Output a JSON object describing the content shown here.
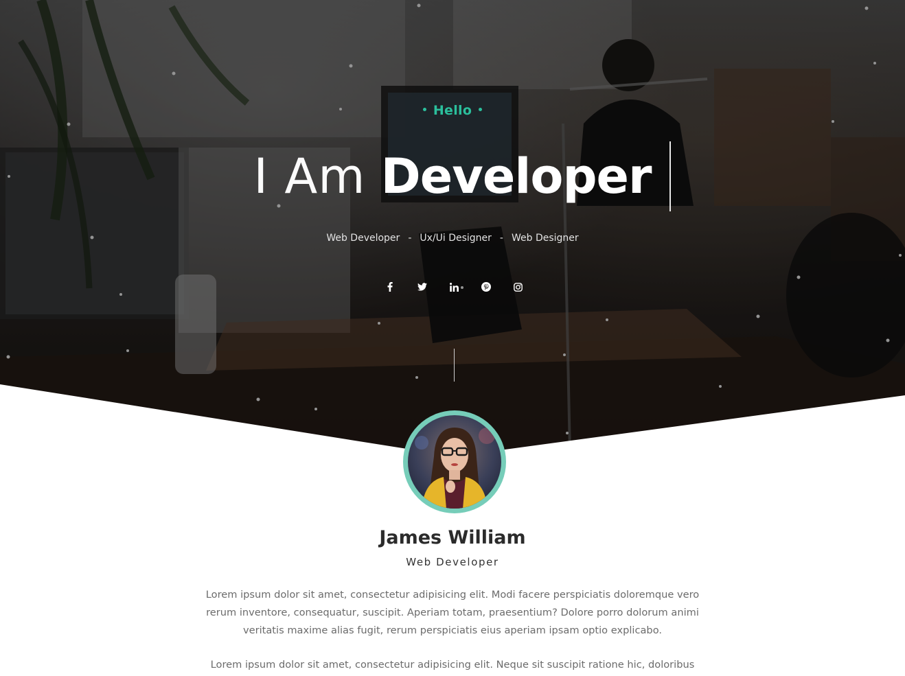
{
  "hero": {
    "greeting": "Hello",
    "headline_prefix": "I Am",
    "headline_word": "Developer",
    "roles": [
      "Web Developer",
      "Ux/Ui Designer",
      "Web Designer"
    ],
    "role_separator": "-",
    "socials": [
      "facebook-icon",
      "twitter-icon",
      "linkedin-icon",
      "pinterest-icon",
      "instagram-icon"
    ]
  },
  "profile": {
    "name": "James William",
    "title": "Web Developer",
    "paragraphs": [
      "Lorem ipsum dolor sit amet, consectetur adipisicing elit. Modi facere perspiciatis doloremque vero rerum inventore, consequatur, suscipit. Aperiam totam, praesentium? Dolore porro dolorum animi veritatis maxime alias fugit, rerum perspiciatis eius aperiam ipsam optio explicabo.",
      "Lorem ipsum dolor sit amet, consectetur adipisicing elit. Neque sit suscipit ratione hic, doloribus"
    ]
  },
  "colors": {
    "accent": "#2bbf9c",
    "avatar_ring": "#76cdb9",
    "heading": "#2b2b2b",
    "body_text": "#6b6b6b"
  }
}
